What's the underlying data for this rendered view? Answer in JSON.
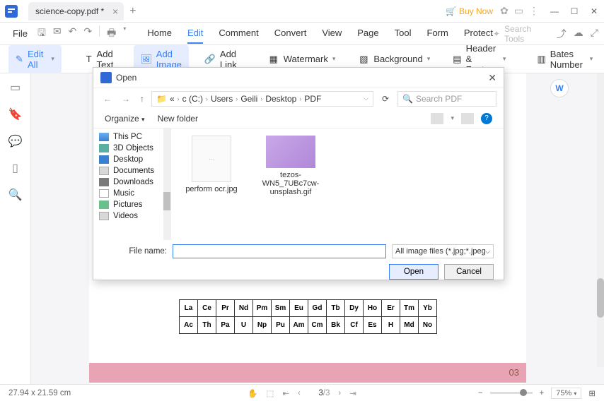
{
  "titlebar": {
    "tab_name": "science-copy.pdf *",
    "buy_now": "Buy Now"
  },
  "menubar": {
    "file": "File",
    "items": [
      "Home",
      "Edit",
      "Comment",
      "Convert",
      "View",
      "Page",
      "Tool",
      "Form",
      "Protect"
    ],
    "active_index": 1,
    "search_placeholder": "Search Tools"
  },
  "toolbar": {
    "edit_all": "Edit All",
    "add_text": "Add Text",
    "add_image": "Add Image",
    "add_link": "Add Link",
    "watermark": "Watermark",
    "background": "Background",
    "header_footer": "Header & Footer",
    "bates_number": "Bates Number"
  },
  "dialog": {
    "title": "Open",
    "breadcrumb": [
      "«",
      "c (C:)",
      "Users",
      "Geili",
      "Desktop",
      "PDF"
    ],
    "search_placeholder": "Search PDF",
    "organize": "Organize",
    "new_folder": "New folder",
    "tree": [
      "This PC",
      "3D Objects",
      "Desktop",
      "Documents",
      "Downloads",
      "Music",
      "Pictures",
      "Videos"
    ],
    "files": [
      {
        "name": "perform ocr.jpg",
        "kind": "jpg"
      },
      {
        "name": "tezos-WN5_7UBc7cw-unsplash.gif",
        "kind": "gif"
      }
    ],
    "filename_label": "File name:",
    "filename_value": "",
    "filter": "All image files (*.jpg;*.jpeg;*.jpe",
    "open_btn": "Open",
    "cancel_btn": "Cancel"
  },
  "periodic": {
    "row1": [
      "La",
      "Ce",
      "Pr",
      "Nd",
      "Pm",
      "Sm",
      "Eu",
      "Gd",
      "Tb",
      "Dy",
      "Ho",
      "Er",
      "Tm",
      "Yb"
    ],
    "row2": [
      "Ac",
      "Th",
      "Pa",
      "U",
      "Np",
      "Pu",
      "Am",
      "Cm",
      "Bk",
      "Cf",
      "Es",
      "H",
      "Md",
      "No"
    ]
  },
  "page_badge": "03",
  "statusbar": {
    "dims": "27.94 x 21.59 cm",
    "page_current": "3",
    "page_total": "/3",
    "zoom": "75%"
  }
}
